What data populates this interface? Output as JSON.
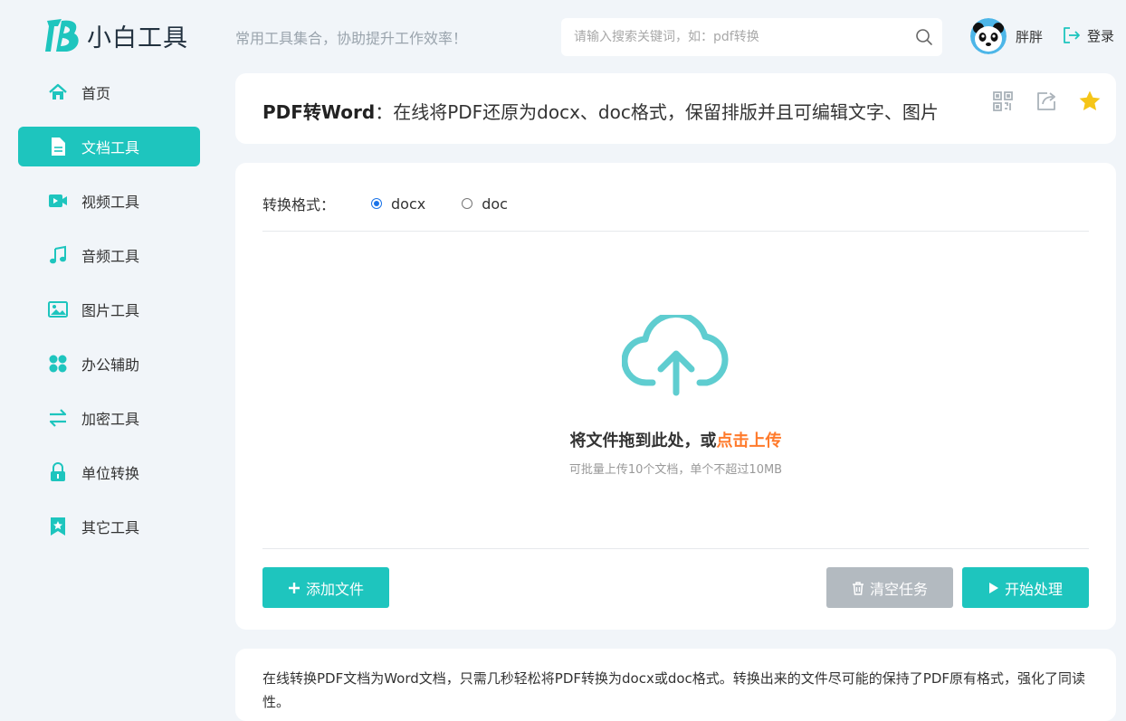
{
  "header": {
    "logo_text": "小白工具",
    "slogan": "常用工具集合，协助提升工作效率！",
    "search_placeholder": "请输入搜索关键词，如：pdf转换",
    "username": "胖胖",
    "login_label": "登录"
  },
  "sidebar": {
    "items": [
      {
        "label": "首页",
        "icon": "home-icon"
      },
      {
        "label": "文档工具",
        "icon": "document-icon",
        "active": true
      },
      {
        "label": "视频工具",
        "icon": "video-icon"
      },
      {
        "label": "音频工具",
        "icon": "music-icon"
      },
      {
        "label": "图片工具",
        "icon": "image-icon"
      },
      {
        "label": "办公辅助",
        "icon": "grid-icon"
      },
      {
        "label": "加密工具",
        "icon": "swap-icon"
      },
      {
        "label": "单位转换",
        "icon": "lock-icon"
      },
      {
        "label": "其它工具",
        "icon": "bookmark-star-icon"
      }
    ]
  },
  "tool": {
    "name": "PDF转Word",
    "description": "：在线将PDF还原为docx、doc格式，保留排版并且可编辑文字、图片"
  },
  "format": {
    "label": "转换格式：",
    "options": [
      "docx",
      "doc"
    ],
    "selected": "docx"
  },
  "upload": {
    "title_prefix": "将文件拖到此处，或",
    "title_link": "点击上传",
    "subtitle": "可批量上传10个文档，单个不超过10MB"
  },
  "buttons": {
    "add": "添加文件",
    "clear": "清空任务",
    "start": "开始处理"
  },
  "description_text": "在线转换PDF文档为Word文档，只需几秒轻松将PDF转换为docx或doc格式。转换出来的文件尽可能的保持了PDF原有格式，强化了同读性。",
  "colors": {
    "accent": "#1ec5be",
    "link_orange": "#ff7a2b",
    "disabled_gray": "#b3bac0",
    "star": "#f5c518",
    "background": "#f1f5f9"
  }
}
